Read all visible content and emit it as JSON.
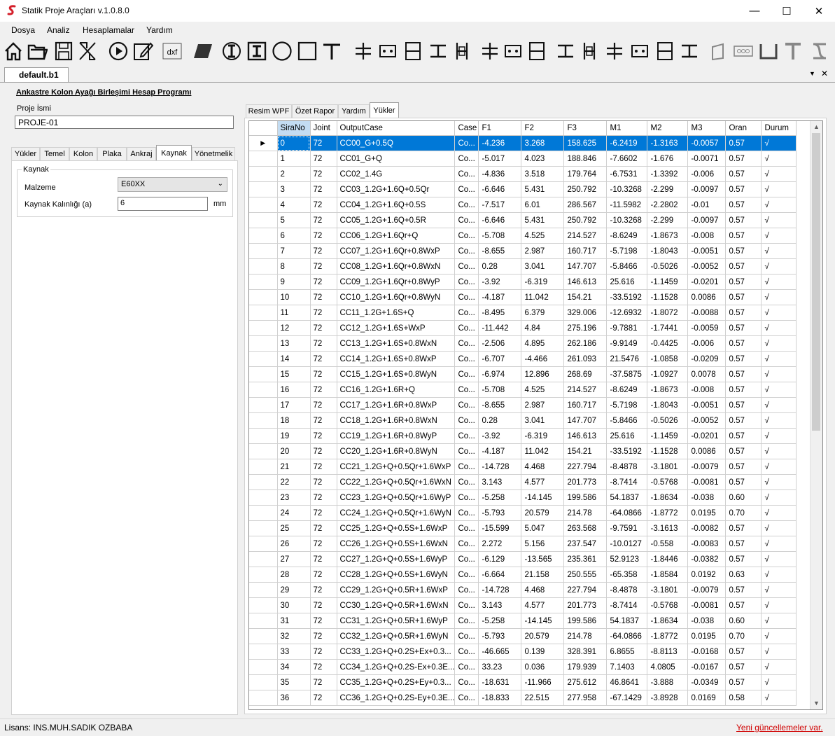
{
  "window": {
    "title": "Statik Proje Araçları v.1.0.8.0",
    "minimize": "—",
    "maximize": "☐",
    "close": "✕"
  },
  "menu": [
    "Dosya",
    "Analiz",
    "Hesaplamalar",
    "Yardım"
  ],
  "toolbar_icons": [
    "home-icon",
    "open-folder-icon",
    "save-icon",
    "tools-icon",
    "play-icon",
    "edit-icon",
    "dxf-icon",
    "plate-icon",
    "i-section-icon",
    "i-section-box-icon",
    "circle-section-icon",
    "square-section-icon",
    "t-section-icon",
    "column-base-icon",
    "column-base-k-icon",
    "beam-column-icon",
    "beam-flange-icon",
    "beam-web-icon",
    "plate-splice-icon",
    "bolt-pattern-icon",
    "moment-splice-icon",
    "brace-icon",
    "column-splice-icon",
    "end-plate-icon",
    "end-plate-2-icon",
    "gusset-icon",
    "gusset-2-icon",
    "purlin-icon",
    "bolt-row-icon",
    "u-channel-icon",
    "tee-icon",
    "s-section-icon"
  ],
  "doc_tab": {
    "label": "default.b1",
    "menu_arrow": "▼",
    "close": "✕"
  },
  "heading": "Ankastre Kolon Ayağı Birleşimi Hesap Programı",
  "project": {
    "label": "Proje İsmi",
    "value": "PROJE-01"
  },
  "left_tabs": [
    "Yükler",
    "Temel",
    "Kolon",
    "Plaka",
    "Ankraj",
    "Kaynak",
    "Yönetmelik"
  ],
  "left_active_tab": "Kaynak",
  "kaynak": {
    "group_title": "Kaynak",
    "malzeme_label": "Malzeme",
    "malzeme_value": "E60XX",
    "kalinlik_label": "Kaynak Kalınlığı (a)",
    "kalinlik_value": "6",
    "kalinlik_unit": "mm"
  },
  "right_tabs": [
    "Resim WPF",
    "Özet Rapor",
    "Yardım",
    "Yükler"
  ],
  "right_active_tab": "Yükler",
  "grid": {
    "columns": [
      "SiraNo",
      "Joint",
      "OutputCase",
      "Case",
      "F1",
      "F2",
      "F3",
      "M1",
      "M2",
      "M3",
      "Oran",
      "Durum"
    ],
    "rows": [
      [
        "0",
        "72",
        "CC00_G+0.5Q",
        "Co...",
        "-4.236",
        "3.268",
        "158.625",
        "-6.2419",
        "-1.3163",
        "-0.0057",
        "0.57",
        "√"
      ],
      [
        "1",
        "72",
        "CC01_G+Q",
        "Co...",
        "-5.017",
        "4.023",
        "188.846",
        "-7.6602",
        "-1.676",
        "-0.0071",
        "0.57",
        "√"
      ],
      [
        "2",
        "72",
        "CC02_1.4G",
        "Co...",
        "-4.836",
        "3.518",
        "179.764",
        "-6.7531",
        "-1.3392",
        "-0.006",
        "0.57",
        "√"
      ],
      [
        "3",
        "72",
        "CC03_1.2G+1.6Q+0.5Qr",
        "Co...",
        "-6.646",
        "5.431",
        "250.792",
        "-10.3268",
        "-2.299",
        "-0.0097",
        "0.57",
        "√"
      ],
      [
        "4",
        "72",
        "CC04_1.2G+1.6Q+0.5S",
        "Co...",
        "-7.517",
        "6.01",
        "286.567",
        "-11.5982",
        "-2.2802",
        "-0.01",
        "0.57",
        "√"
      ],
      [
        "5",
        "72",
        "CC05_1.2G+1.6Q+0.5R",
        "Co...",
        "-6.646",
        "5.431",
        "250.792",
        "-10.3268",
        "-2.299",
        "-0.0097",
        "0.57",
        "√"
      ],
      [
        "6",
        "72",
        "CC06_1.2G+1.6Qr+Q",
        "Co...",
        "-5.708",
        "4.525",
        "214.527",
        "-8.6249",
        "-1.8673",
        "-0.008",
        "0.57",
        "√"
      ],
      [
        "7",
        "72",
        "CC07_1.2G+1.6Qr+0.8WxP",
        "Co...",
        "-8.655",
        "2.987",
        "160.717",
        "-5.7198",
        "-1.8043",
        "-0.0051",
        "0.57",
        "√"
      ],
      [
        "8",
        "72",
        "CC08_1.2G+1.6Qr+0.8WxN",
        "Co...",
        "0.28",
        "3.041",
        "147.707",
        "-5.8466",
        "-0.5026",
        "-0.0052",
        "0.57",
        "√"
      ],
      [
        "9",
        "72",
        "CC09_1.2G+1.6Qr+0.8WyP",
        "Co...",
        "-3.92",
        "-6.319",
        "146.613",
        "25.616",
        "-1.1459",
        "-0.0201",
        "0.57",
        "√"
      ],
      [
        "10",
        "72",
        "CC10_1.2G+1.6Qr+0.8WyN",
        "Co...",
        "-4.187",
        "11.042",
        "154.21",
        "-33.5192",
        "-1.1528",
        "0.0086",
        "0.57",
        "√"
      ],
      [
        "11",
        "72",
        "CC11_1.2G+1.6S+Q",
        "Co...",
        "-8.495",
        "6.379",
        "329.006",
        "-12.6932",
        "-1.8072",
        "-0.0088",
        "0.57",
        "√"
      ],
      [
        "12",
        "72",
        "CC12_1.2G+1.6S+WxP",
        "Co...",
        "-11.442",
        "4.84",
        "275.196",
        "-9.7881",
        "-1.7441",
        "-0.0059",
        "0.57",
        "√"
      ],
      [
        "13",
        "72",
        "CC13_1.2G+1.6S+0.8WxN",
        "Co...",
        "-2.506",
        "4.895",
        "262.186",
        "-9.9149",
        "-0.4425",
        "-0.006",
        "0.57",
        "√"
      ],
      [
        "14",
        "72",
        "CC14_1.2G+1.6S+0.8WxP",
        "Co...",
        "-6.707",
        "-4.466",
        "261.093",
        "21.5476",
        "-1.0858",
        "-0.0209",
        "0.57",
        "√"
      ],
      [
        "15",
        "72",
        "CC15_1.2G+1.6S+0.8WyN",
        "Co...",
        "-6.974",
        "12.896",
        "268.69",
        "-37.5875",
        "-1.0927",
        "0.0078",
        "0.57",
        "√"
      ],
      [
        "16",
        "72",
        "CC16_1.2G+1.6R+Q",
        "Co...",
        "-5.708",
        "4.525",
        "214.527",
        "-8.6249",
        "-1.8673",
        "-0.008",
        "0.57",
        "√"
      ],
      [
        "17",
        "72",
        "CC17_1.2G+1.6R+0.8WxP",
        "Co...",
        "-8.655",
        "2.987",
        "160.717",
        "-5.7198",
        "-1.8043",
        "-0.0051",
        "0.57",
        "√"
      ],
      [
        "18",
        "72",
        "CC18_1.2G+1.6R+0.8WxN",
        "Co...",
        "0.28",
        "3.041",
        "147.707",
        "-5.8466",
        "-0.5026",
        "-0.0052",
        "0.57",
        "√"
      ],
      [
        "19",
        "72",
        "CC19_1.2G+1.6R+0.8WyP",
        "Co...",
        "-3.92",
        "-6.319",
        "146.613",
        "25.616",
        "-1.1459",
        "-0.0201",
        "0.57",
        "√"
      ],
      [
        "20",
        "72",
        "CC20_1.2G+1.6R+0.8WyN",
        "Co...",
        "-4.187",
        "11.042",
        "154.21",
        "-33.5192",
        "-1.1528",
        "0.0086",
        "0.57",
        "√"
      ],
      [
        "21",
        "72",
        "CC21_1.2G+Q+0.5Qr+1.6WxP",
        "Co...",
        "-14.728",
        "4.468",
        "227.794",
        "-8.4878",
        "-3.1801",
        "-0.0079",
        "0.57",
        "√"
      ],
      [
        "22",
        "72",
        "CC22_1.2G+Q+0.5Qr+1.6WxN",
        "Co...",
        "3.143",
        "4.577",
        "201.773",
        "-8.7414",
        "-0.5768",
        "-0.0081",
        "0.57",
        "√"
      ],
      [
        "23",
        "72",
        "CC23_1.2G+Q+0.5Qr+1.6WyP",
        "Co...",
        "-5.258",
        "-14.145",
        "199.586",
        "54.1837",
        "-1.8634",
        "-0.038",
        "0.60",
        "√"
      ],
      [
        "24",
        "72",
        "CC24_1.2G+Q+0.5Qr+1.6WyN",
        "Co...",
        "-5.793",
        "20.579",
        "214.78",
        "-64.0866",
        "-1.8772",
        "0.0195",
        "0.70",
        "√"
      ],
      [
        "25",
        "72",
        "CC25_1.2G+Q+0.5S+1.6WxP",
        "Co...",
        "-15.599",
        "5.047",
        "263.568",
        "-9.7591",
        "-3.1613",
        "-0.0082",
        "0.57",
        "√"
      ],
      [
        "26",
        "72",
        "CC26_1.2G+Q+0.5S+1.6WxN",
        "Co...",
        "2.272",
        "5.156",
        "237.547",
        "-10.0127",
        "-0.558",
        "-0.0083",
        "0.57",
        "√"
      ],
      [
        "27",
        "72",
        "CC27_1.2G+Q+0.5S+1.6WyP",
        "Co...",
        "-6.129",
        "-13.565",
        "235.361",
        "52.9123",
        "-1.8446",
        "-0.0382",
        "0.57",
        "√"
      ],
      [
        "28",
        "72",
        "CC28_1.2G+Q+0.5S+1.6WyN",
        "Co...",
        "-6.664",
        "21.158",
        "250.555",
        "-65.358",
        "-1.8584",
        "0.0192",
        "0.63",
        "√"
      ],
      [
        "29",
        "72",
        "CC29_1.2G+Q+0.5R+1.6WxP",
        "Co...",
        "-14.728",
        "4.468",
        "227.794",
        "-8.4878",
        "-3.1801",
        "-0.0079",
        "0.57",
        "√"
      ],
      [
        "30",
        "72",
        "CC30_1.2G+Q+0.5R+1.6WxN",
        "Co...",
        "3.143",
        "4.577",
        "201.773",
        "-8.7414",
        "-0.5768",
        "-0.0081",
        "0.57",
        "√"
      ],
      [
        "31",
        "72",
        "CC31_1.2G+Q+0.5R+1.6WyP",
        "Co...",
        "-5.258",
        "-14.145",
        "199.586",
        "54.1837",
        "-1.8634",
        "-0.038",
        "0.60",
        "√"
      ],
      [
        "32",
        "72",
        "CC32_1.2G+Q+0.5R+1.6WyN",
        "Co...",
        "-5.793",
        "20.579",
        "214.78",
        "-64.0866",
        "-1.8772",
        "0.0195",
        "0.70",
        "√"
      ],
      [
        "33",
        "72",
        "CC33_1.2G+Q+0.2S+Ex+0.3...",
        "Co...",
        "-46.665",
        "0.139",
        "328.391",
        "6.8655",
        "-8.8113",
        "-0.0168",
        "0.57",
        "√"
      ],
      [
        "34",
        "72",
        "CC34_1.2G+Q+0.2S-Ex+0.3E...",
        "Co...",
        "33.23",
        "0.036",
        "179.939",
        "7.1403",
        "4.0805",
        "-0.0167",
        "0.57",
        "√"
      ],
      [
        "35",
        "72",
        "CC35_1.2G+Q+0.2S+Ey+0.3...",
        "Co...",
        "-18.631",
        "-11.966",
        "275.612",
        "46.8641",
        "-3.888",
        "-0.0349",
        "0.57",
        "√"
      ],
      [
        "36",
        "72",
        "CC36_1.2G+Q+0.2S-Ey+0.3E...",
        "Co...",
        "-18.833",
        "22.515",
        "277.958",
        "-67.1429",
        "-3.8928",
        "0.0169",
        "0.58",
        "√"
      ]
    ],
    "selected_row": 0,
    "row_marker": "▶"
  },
  "status": {
    "license": "Lisans: INS.MUH.SADIK OZBABA",
    "updates": "Yeni güncellemeler var."
  },
  "colors": {
    "selection": "#0078d7",
    "update_link": "#d00000",
    "sorted_header": "#c3dcf2"
  }
}
